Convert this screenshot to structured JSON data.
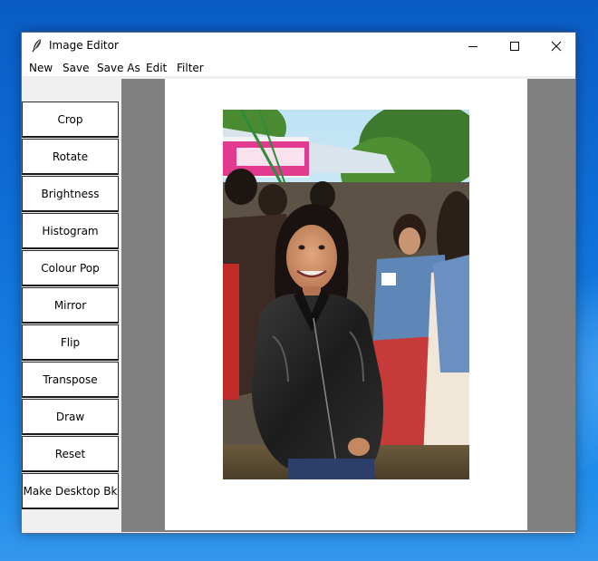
{
  "window": {
    "title": "Image Editor",
    "icon": "feather-icon"
  },
  "menu": {
    "items": [
      "New",
      "Save",
      "Save As",
      "Edit",
      "Filter"
    ]
  },
  "sidebar": {
    "buttons": [
      "Crop",
      "Rotate",
      "Brightness",
      "Histogram",
      "Colour Pop",
      "Mirror",
      "Flip",
      "Transpose",
      "Draw",
      "Reset",
      "Make Desktop Bk"
    ]
  },
  "canvas": {
    "photo_subject": "photo-of-woman-in-leather-jacket"
  },
  "colors": {
    "canvas_bg": "#808080",
    "paper": "#ffffff",
    "desktop": "#0f6fd8"
  }
}
